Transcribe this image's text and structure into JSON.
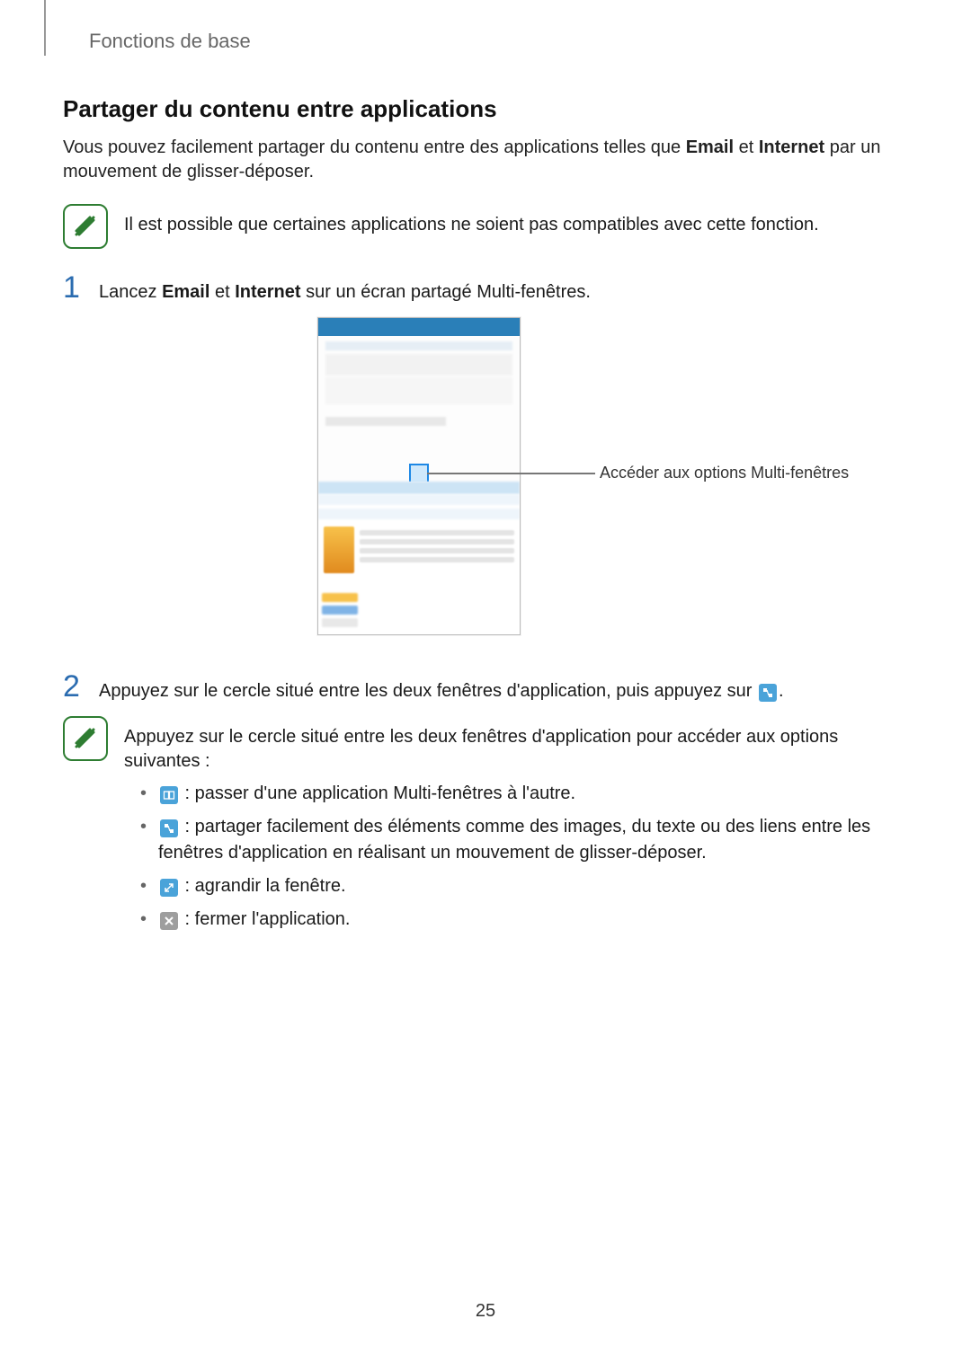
{
  "breadcrumb": "Fonctions de base",
  "section_title": "Partager du contenu entre applications",
  "intro_parts": {
    "a": "Vous pouvez facilement partager du contenu entre des applications telles que ",
    "b": "Email",
    "c": " et ",
    "d": "Internet",
    "e": " par un mouvement de glisser-déposer."
  },
  "note1": "Il est possible que certaines applications ne soient pas compatibles avec cette fonction.",
  "step1": {
    "num": "1",
    "a": "Lancez ",
    "b": "Email",
    "c": " et ",
    "d": "Internet",
    "e": " sur un écran partagé Multi-fenêtres."
  },
  "callout": "Accéder aux options Multi-fenêtres",
  "step2": {
    "num": "2",
    "a": "Appuyez sur le cercle situé entre les deux fenêtres d'application, puis appuyez sur ",
    "b": "."
  },
  "note2": "Appuyez sur le cercle situé entre les deux fenêtres d'application pour accéder aux options suivantes :",
  "bullets": {
    "switch": " : passer d'une application Multi-fenêtres à l'autre.",
    "share": " : partager facilement des éléments comme des images, du texte ou des liens entre les fenêtres d'application en réalisant un mouvement de glisser-déposer.",
    "expand": " : agrandir la fenêtre.",
    "close": " : fermer l'application."
  },
  "page_number": "25"
}
